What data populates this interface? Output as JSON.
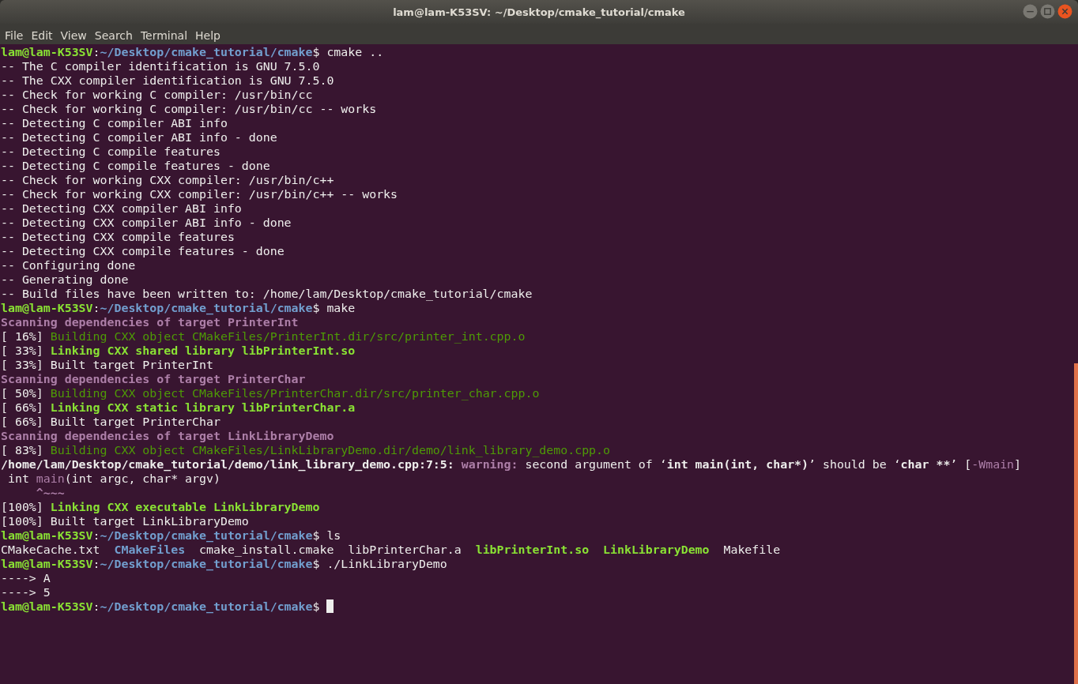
{
  "window": {
    "title": "lam@lam-K53SV: ~/Desktop/cmake_tutorial/cmake"
  },
  "menu": [
    "File",
    "Edit",
    "View",
    "Search",
    "Terminal",
    "Help"
  ],
  "terminal": {
    "lines": [
      [
        {
          "text": "lam@lam-K53SV",
          "kind": "user"
        },
        {
          "text": ":",
          "kind": "plain"
        },
        {
          "text": "~/Desktop/cmake_tutorial/cmake",
          "kind": "path"
        },
        {
          "text": "$ cmake ..",
          "kind": "plain"
        }
      ],
      [
        {
          "text": "-- The C compiler identification is GNU 7.5.0",
          "kind": "plain"
        }
      ],
      [
        {
          "text": "-- The CXX compiler identification is GNU 7.5.0",
          "kind": "plain"
        }
      ],
      [
        {
          "text": "-- Check for working C compiler: /usr/bin/cc",
          "kind": "plain"
        }
      ],
      [
        {
          "text": "-- Check for working C compiler: /usr/bin/cc -- works",
          "kind": "plain"
        }
      ],
      [
        {
          "text": "-- Detecting C compiler ABI info",
          "kind": "plain"
        }
      ],
      [
        {
          "text": "-- Detecting C compiler ABI info - done",
          "kind": "plain"
        }
      ],
      [
        {
          "text": "-- Detecting C compile features",
          "kind": "plain"
        }
      ],
      [
        {
          "text": "-- Detecting C compile features - done",
          "kind": "plain"
        }
      ],
      [
        {
          "text": "-- Check for working CXX compiler: /usr/bin/c++",
          "kind": "plain"
        }
      ],
      [
        {
          "text": "-- Check for working CXX compiler: /usr/bin/c++ -- works",
          "kind": "plain"
        }
      ],
      [
        {
          "text": "-- Detecting CXX compiler ABI info",
          "kind": "plain"
        }
      ],
      [
        {
          "text": "-- Detecting CXX compiler ABI info - done",
          "kind": "plain"
        }
      ],
      [
        {
          "text": "-- Detecting CXX compile features",
          "kind": "plain"
        }
      ],
      [
        {
          "text": "-- Detecting CXX compile features - done",
          "kind": "plain"
        }
      ],
      [
        {
          "text": "-- Configuring done",
          "kind": "plain"
        }
      ],
      [
        {
          "text": "-- Generating done",
          "kind": "plain"
        }
      ],
      [
        {
          "text": "-- Build files have been written to: /home/lam/Desktop/cmake_tutorial/cmake",
          "kind": "plain"
        }
      ],
      [
        {
          "text": "lam@lam-K53SV",
          "kind": "user"
        },
        {
          "text": ":",
          "kind": "plain"
        },
        {
          "text": "~/Desktop/cmake_tutorial/cmake",
          "kind": "path"
        },
        {
          "text": "$ make",
          "kind": "plain"
        }
      ],
      [
        {
          "text": "Scanning dependencies of target PrinterInt",
          "kind": "scan"
        }
      ],
      [
        {
          "text": "[ 16%] ",
          "kind": "plain"
        },
        {
          "text": "Building CXX object CMakeFiles/PrinterInt.dir/src/printer_int.cpp.o",
          "kind": "build"
        }
      ],
      [
        {
          "text": "[ 33%] ",
          "kind": "plain"
        },
        {
          "text": "Linking CXX shared library libPrinterInt.so",
          "kind": "link"
        }
      ],
      [
        {
          "text": "[ 33%] Built target PrinterInt",
          "kind": "plain"
        }
      ],
      [
        {
          "text": "Scanning dependencies of target PrinterChar",
          "kind": "scan"
        }
      ],
      [
        {
          "text": "[ 50%] ",
          "kind": "plain"
        },
        {
          "text": "Building CXX object CMakeFiles/PrinterChar.dir/src/printer_char.cpp.o",
          "kind": "build"
        }
      ],
      [
        {
          "text": "[ 66%] ",
          "kind": "plain"
        },
        {
          "text": "Linking CXX static library libPrinterChar.a",
          "kind": "link"
        }
      ],
      [
        {
          "text": "[ 66%] Built target PrinterChar",
          "kind": "plain"
        }
      ],
      [
        {
          "text": "Scanning dependencies of target LinkLibraryDemo",
          "kind": "scan"
        }
      ],
      [
        {
          "text": "[ 83%] ",
          "kind": "plain"
        },
        {
          "text": "Building CXX object CMakeFiles/LinkLibraryDemo.dir/demo/link_library_demo.cpp.o",
          "kind": "build"
        }
      ],
      [
        {
          "text": "/home/lam/Desktop/cmake_tutorial/demo/link_library_demo.cpp:7:5: ",
          "kind": "bold"
        },
        {
          "text": "warning: ",
          "kind": "warning"
        },
        {
          "text": "second argument of ‘",
          "kind": "plain"
        },
        {
          "text": "int main(int, char*)",
          "kind": "bold"
        },
        {
          "text": "’ should be ‘",
          "kind": "plain"
        },
        {
          "text": "char **",
          "kind": "bold"
        },
        {
          "text": "’ [",
          "kind": "plain"
        },
        {
          "text": "-Wmain",
          "kind": "flag"
        },
        {
          "text": "]",
          "kind": "plain"
        }
      ],
      [
        {
          "text": " int ",
          "kind": "plain"
        },
        {
          "text": "main",
          "kind": "flag"
        },
        {
          "text": "(int argc, char* argv)",
          "kind": "plain"
        }
      ],
      [
        {
          "text": "     ^~~~",
          "kind": "warning"
        }
      ],
      [
        {
          "text": "[100%] ",
          "kind": "plain"
        },
        {
          "text": "Linking CXX executable LinkLibraryDemo",
          "kind": "link"
        }
      ],
      [
        {
          "text": "[100%] Built target LinkLibraryDemo",
          "kind": "plain"
        }
      ],
      [
        {
          "text": "lam@lam-K53SV",
          "kind": "user"
        },
        {
          "text": ":",
          "kind": "plain"
        },
        {
          "text": "~/Desktop/cmake_tutorial/cmake",
          "kind": "path"
        },
        {
          "text": "$ ls",
          "kind": "plain"
        }
      ],
      [
        {
          "text": "CMakeCache.txt  ",
          "kind": "plain"
        },
        {
          "text": "CMakeFiles",
          "kind": "path"
        },
        {
          "text": "  cmake_install.cmake  libPrinterChar.a  ",
          "kind": "plain"
        },
        {
          "text": "libPrinterInt.so  ",
          "kind": "link"
        },
        {
          "text": "LinkLibraryDemo",
          "kind": "link"
        },
        {
          "text": "  Makefile",
          "kind": "plain"
        }
      ],
      [
        {
          "text": "lam@lam-K53SV",
          "kind": "user"
        },
        {
          "text": ":",
          "kind": "plain"
        },
        {
          "text": "~/Desktop/cmake_tutorial/cmake",
          "kind": "path"
        },
        {
          "text": "$ ./LinkLibraryDemo",
          "kind": "plain"
        }
      ],
      [
        {
          "text": "----> A",
          "kind": "plain"
        }
      ],
      [
        {
          "text": "----> 5",
          "kind": "plain"
        }
      ],
      [
        {
          "text": "lam@lam-K53SV",
          "kind": "user"
        },
        {
          "text": ":",
          "kind": "plain"
        },
        {
          "text": "~/Desktop/cmake_tutorial/cmake",
          "kind": "path"
        },
        {
          "text": "$ ",
          "kind": "plain"
        }
      ]
    ]
  }
}
